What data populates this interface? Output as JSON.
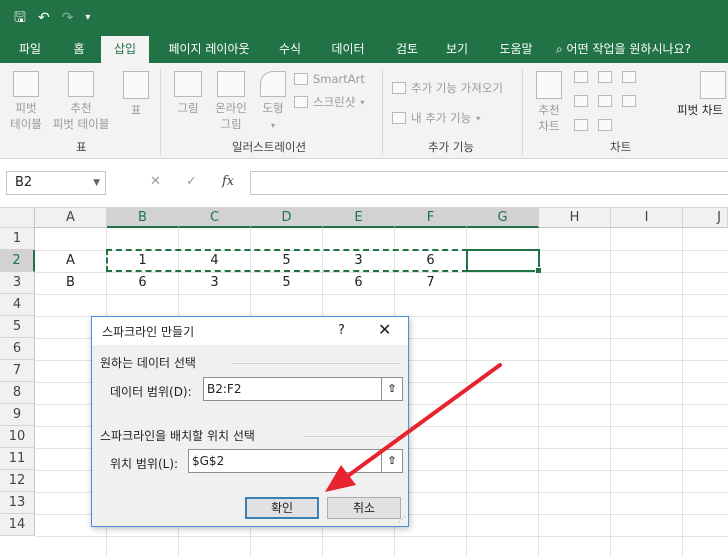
{
  "quick_access": {
    "save_icon": "save-icon",
    "undo_icon": "undo-icon",
    "redo_icon": "redo-icon",
    "customize_icon": "customize-icon"
  },
  "tabs": [
    {
      "label": "파일"
    },
    {
      "label": "홈"
    },
    {
      "label": "삽입",
      "active": true
    },
    {
      "label": "페이지 레이아웃"
    },
    {
      "label": "수식"
    },
    {
      "label": "데이터"
    },
    {
      "label": "검토"
    },
    {
      "label": "보기"
    },
    {
      "label": "도움말"
    },
    {
      "label": "어떤 작업을 원하시나요?"
    }
  ],
  "ribbon": {
    "pivot_table": "피벗\n테이블",
    "recommended_pivot": "추천\n피벗 테이블",
    "table": "표",
    "group_table": "표",
    "picture": "그림",
    "online_picture": "온라인\n그림",
    "shapes": "도형",
    "smartart": "SmartArt",
    "screenshot": "스크린샷",
    "group_illustrations": "일러스트레이션",
    "get_addins": "추가 기능 가져오기",
    "my_addins": "내 추가 기능",
    "group_addins": "추가 기능",
    "recommended_charts": "추천\n차트",
    "pivot_chart": "피벗 차트",
    "group_charts": "차트"
  },
  "formula_bar": {
    "name_box": "B2",
    "cancel": "✕",
    "enter": "✓",
    "fx": "fx",
    "value": ""
  },
  "grid": {
    "columns": [
      "A",
      "B",
      "C",
      "D",
      "E",
      "F",
      "G",
      "H",
      "I",
      "J"
    ],
    "rows": [
      "1",
      "2",
      "3",
      "4",
      "5",
      "6",
      "7",
      "8",
      "9",
      "10",
      "11",
      "12",
      "13",
      "14"
    ],
    "cells": [
      {
        "label": "A",
        "values": [
          "1",
          "4",
          "5",
          "3",
          "6"
        ]
      },
      {
        "label": "B",
        "values": [
          "6",
          "3",
          "5",
          "6",
          "7"
        ]
      }
    ]
  },
  "dialog": {
    "title": "스파크라인 만들기",
    "help": "?",
    "close": "✕",
    "section_data": "원하는 데이터 선택",
    "data_range_label": "데이터 범위(D):",
    "data_range_value": "B2:F2",
    "section_location": "스파크라인을 배치할 위치 선택",
    "location_label": "위치 범위(L):",
    "location_value": "$G$2",
    "ok": "확인",
    "cancel": "취소"
  },
  "annotation_color": "#e8232f",
  "accent": "#217346"
}
